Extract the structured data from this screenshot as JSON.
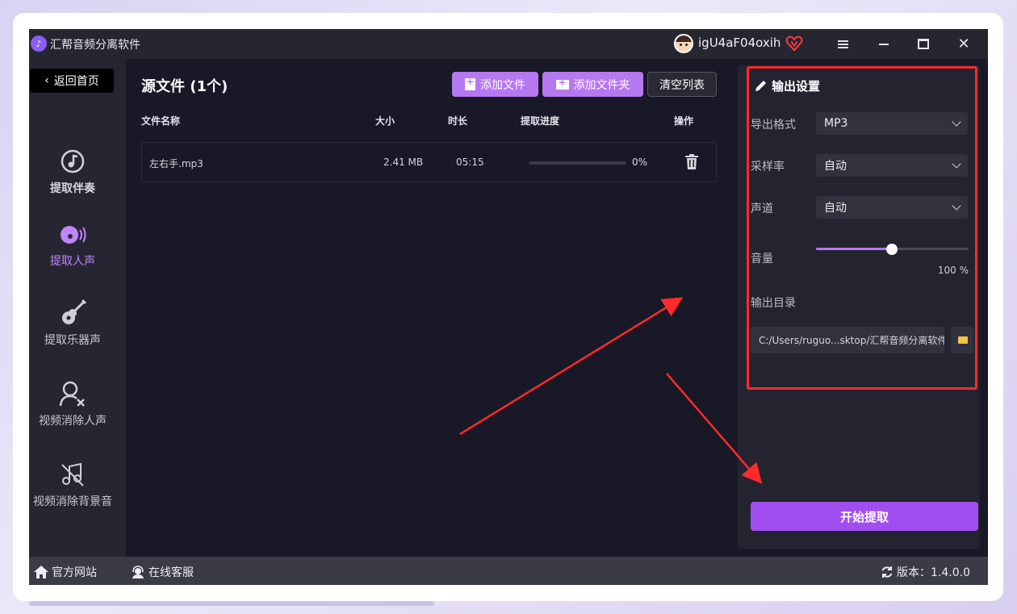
{
  "app": {
    "title": "汇帮音频分离软件",
    "username": "igU4aF04oxih"
  },
  "sidebar": {
    "back_label": "返回首页",
    "items": [
      {
        "label": "提取伴奏"
      },
      {
        "label": "提取人声"
      },
      {
        "label": "提取乐器声"
      },
      {
        "label": "视频消除人声"
      },
      {
        "label": "视频消除背景音"
      }
    ]
  },
  "main": {
    "title": "源文件 (1个)",
    "buttons": {
      "add_file": "添加文件",
      "add_folder": "添加文件夹",
      "clear": "清空列表"
    },
    "columns": {
      "name": "文件名称",
      "size": "大小",
      "duration": "时长",
      "progress": "提取进度",
      "action": "操作"
    },
    "files": [
      {
        "name": "左右手.mp3",
        "size": "2.41 MB",
        "duration": "05:15",
        "progress_text": "0%",
        "progress": 0
      }
    ]
  },
  "settings": {
    "title": "输出设置",
    "format_label": "导出格式",
    "format_value": "MP3",
    "samplerate_label": "采样率",
    "samplerate_value": "自动",
    "channel_label": "声道",
    "channel_value": "自动",
    "volume_label": "音量",
    "volume_value": "100 %",
    "volume_fraction": 0.5,
    "output_dir_label": "输出目录",
    "output_dir_value": "C:/Users/ruguo...sktop/汇帮音频分离软件",
    "start_label": "开始提取"
  },
  "footer": {
    "website": "官方网站",
    "service": "在线客服",
    "version": "版本：1.4.0.0"
  },
  "colors": {
    "accent": "#b678f0",
    "start": "#a14ef0",
    "highlight": "#ff2a2a",
    "bg": "#181826"
  }
}
